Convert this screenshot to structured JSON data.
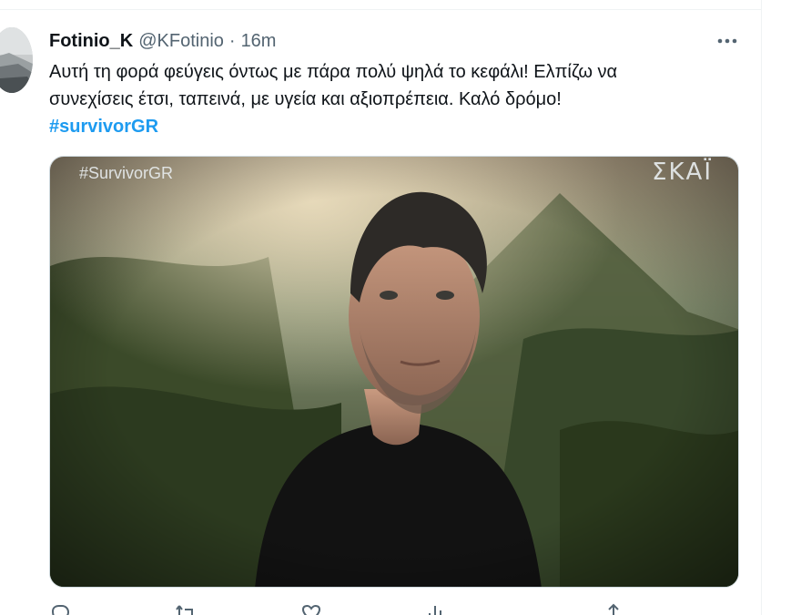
{
  "tweet": {
    "display_name": "Fotinio_K",
    "handle": "@KFotinio",
    "separator": "·",
    "time": "16m",
    "text_line1": "Αυτή τη φορά φεύγεις όντως με πάρα πολύ ψηλά το κεφάλι! Ελπίζω να",
    "text_line2": "συνεχίσεις έτσι, ταπεινά, με υγεία και αξιοπρέπεια. Καλό δρόμο!",
    "hashtag": "#survivorGR"
  },
  "media": {
    "tag": "#SurvivorGR",
    "logo": "ΣΚΑΪ"
  },
  "actions": [
    {
      "name": "reply-icon",
      "count": ""
    },
    {
      "name": "retweet-icon",
      "count": ""
    },
    {
      "name": "like-icon",
      "count": ""
    },
    {
      "name": "views-icon",
      "count": ""
    },
    {
      "name": "share-icon",
      "count": ""
    }
  ],
  "colors": {
    "text": "#0f1419",
    "secondary": "#536471",
    "link": "#1d9bf0",
    "divider": "#eff3f4"
  }
}
